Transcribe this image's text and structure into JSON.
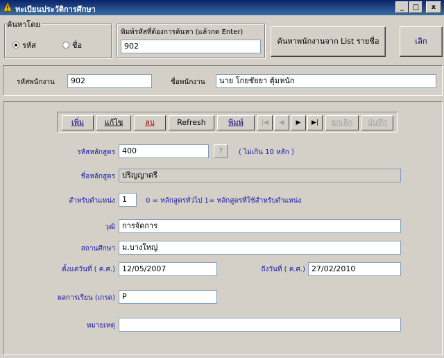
{
  "window": {
    "title": "ทะเบียนประวัติการศึกษา",
    "controls": {
      "minimize": "_",
      "maximize": "□",
      "close": "x"
    }
  },
  "search": {
    "group_label": "ค้นหาโดย",
    "radio_code": "รหัส",
    "radio_name": "ชื่อ",
    "selected": "code",
    "field_label": "พิมพ์รหัสที่ต้องการค้นหา (แล้วกด Enter)",
    "field_value": "902",
    "list_button": "ค้นหาพนักงานจาก List รายชื่อ",
    "cancel_button": "เลิก"
  },
  "employee": {
    "code_label": "รหัสพนักงาน",
    "code_value": "902",
    "name_label": "ชื่อพนักงาน",
    "name_value": "นาย โกยชัยยา ตุ้มหนัก"
  },
  "toolbar": {
    "add": "เพิ่ม",
    "edit": "แก้ไข",
    "delete": "ลบ",
    "refresh": "Refresh",
    "print": "พิมพ์",
    "first": "|◀",
    "prev": "◀",
    "next": "▶",
    "last": "▶|",
    "undo": "ยกเลิก",
    "save": "บันทึก"
  },
  "form": {
    "course_code_label": "รหัสหลักสูตร",
    "course_code_value": "400",
    "course_code_help": "?",
    "course_code_hint": "( ไม่เกิน 10 หลัก )",
    "course_name_label": "ชื่อหลักสูตร",
    "course_name_value": "ปริญญาตรี",
    "position_label": "สำหรับตำแหน่ง",
    "position_value": "1",
    "position_hint": "0 = หลักสูตรทั่วไป  1= หลักสูตรที่ใช้สำหรับตำแหน่ง",
    "degree_label": "วุฒิ",
    "degree_value": "การจัดการ",
    "institution_label": "สถานศึกษา",
    "institution_value": "ม.บางใหญ่",
    "start_date_label": "ตั้งแต่วันที่ ( ค.ศ.)",
    "start_date_value": "12/05/2007",
    "end_date_label": "ถึงวันที่ ( ค.ศ.)",
    "end_date_value": "27/02/2010",
    "grade_label": "ผลการเรียน (เกรด)",
    "grade_value": "P",
    "remark_label": "หมายเหตุ",
    "remark_value": ""
  },
  "colors": {
    "titlebar": "#0a246a",
    "label_blue": "#1a1aa8",
    "face": "#d4d0c8"
  }
}
